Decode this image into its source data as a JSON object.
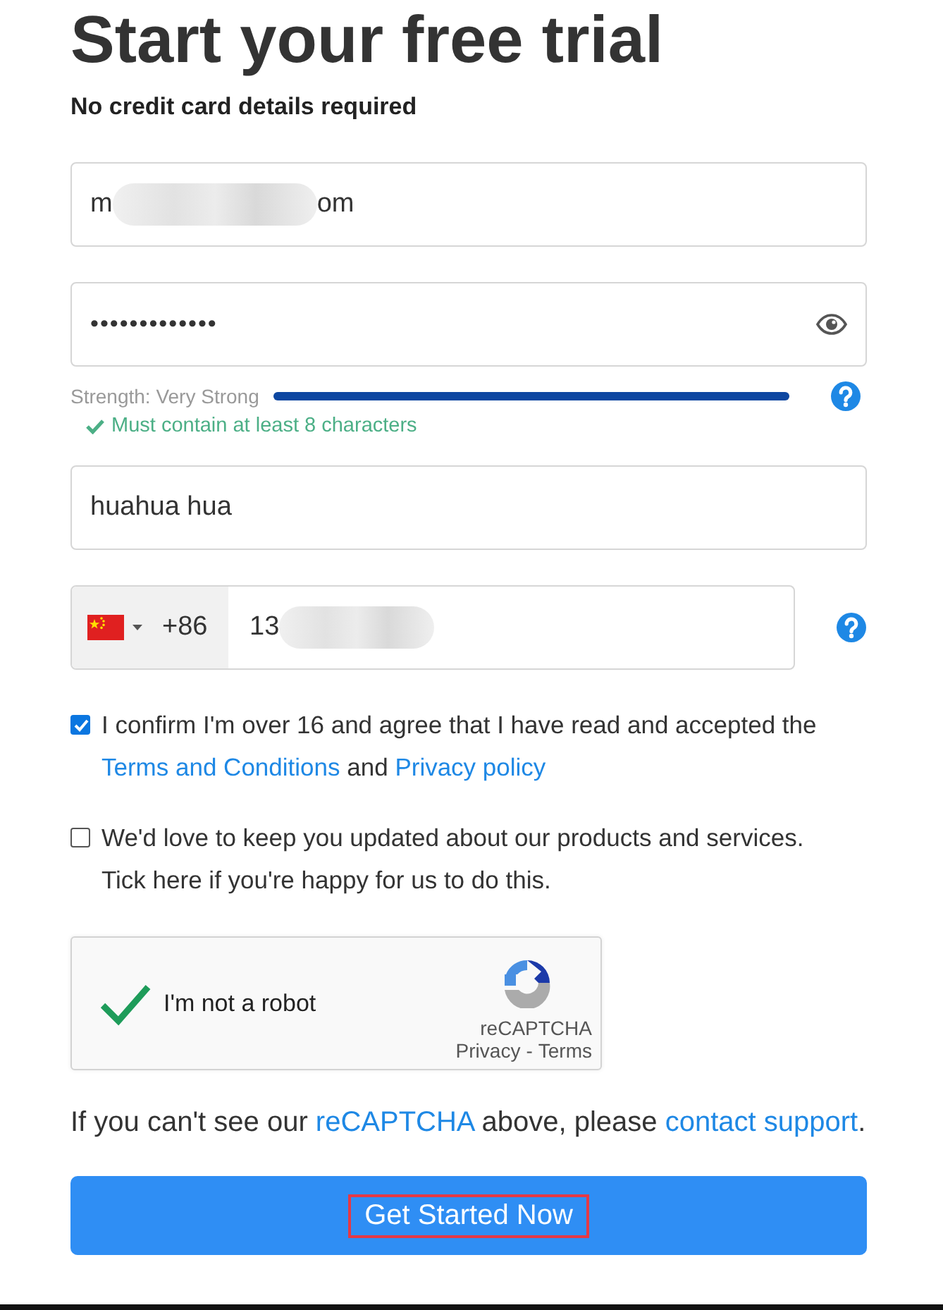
{
  "title": "Start your free trial",
  "subtitle": "No credit card details required",
  "email": {
    "value_start": "m",
    "value_end": "om",
    "redacted": true
  },
  "password": {
    "value": "•••••••••••••",
    "strength_label": "Strength: Very Strong",
    "level": 1.0,
    "rules": [
      {
        "text": "Must contain at least 8 characters",
        "met": true
      }
    ]
  },
  "name": {
    "value": "huahua hua"
  },
  "phone": {
    "dial_code": "+86",
    "value_start": "13",
    "redacted": true
  },
  "consents": [
    {
      "checked": true,
      "parts": [
        {
          "kind": "text",
          "text": "I confirm I'm over 16 and agree that I have read and accepted the "
        },
        {
          "kind": "link",
          "text": "Terms and Conditions"
        },
        {
          "kind": "text",
          "text": " and "
        },
        {
          "kind": "link",
          "text": "Privacy policy"
        }
      ]
    },
    {
      "checked": false,
      "parts": [
        {
          "kind": "text",
          "text": "We'd love to keep you updated about our products and services. Tick here if you're happy for us to do this."
        }
      ]
    }
  ],
  "captcha": {
    "label": "I'm not a robot",
    "checked": true,
    "brand": "reCAPTCHA",
    "privacy": "Privacy",
    "separator": "-",
    "terms": "Terms"
  },
  "support_note": [
    {
      "kind": "text",
      "text": "If you can't see our "
    },
    {
      "kind": "link",
      "text": "reCAPTCHA"
    },
    {
      "kind": "text",
      "text": " above, please "
    },
    {
      "kind": "link",
      "text": "contact support"
    },
    {
      "kind": "text",
      "text": "."
    }
  ],
  "submit": {
    "label": "Get Started Now",
    "highlighted": true
  }
}
